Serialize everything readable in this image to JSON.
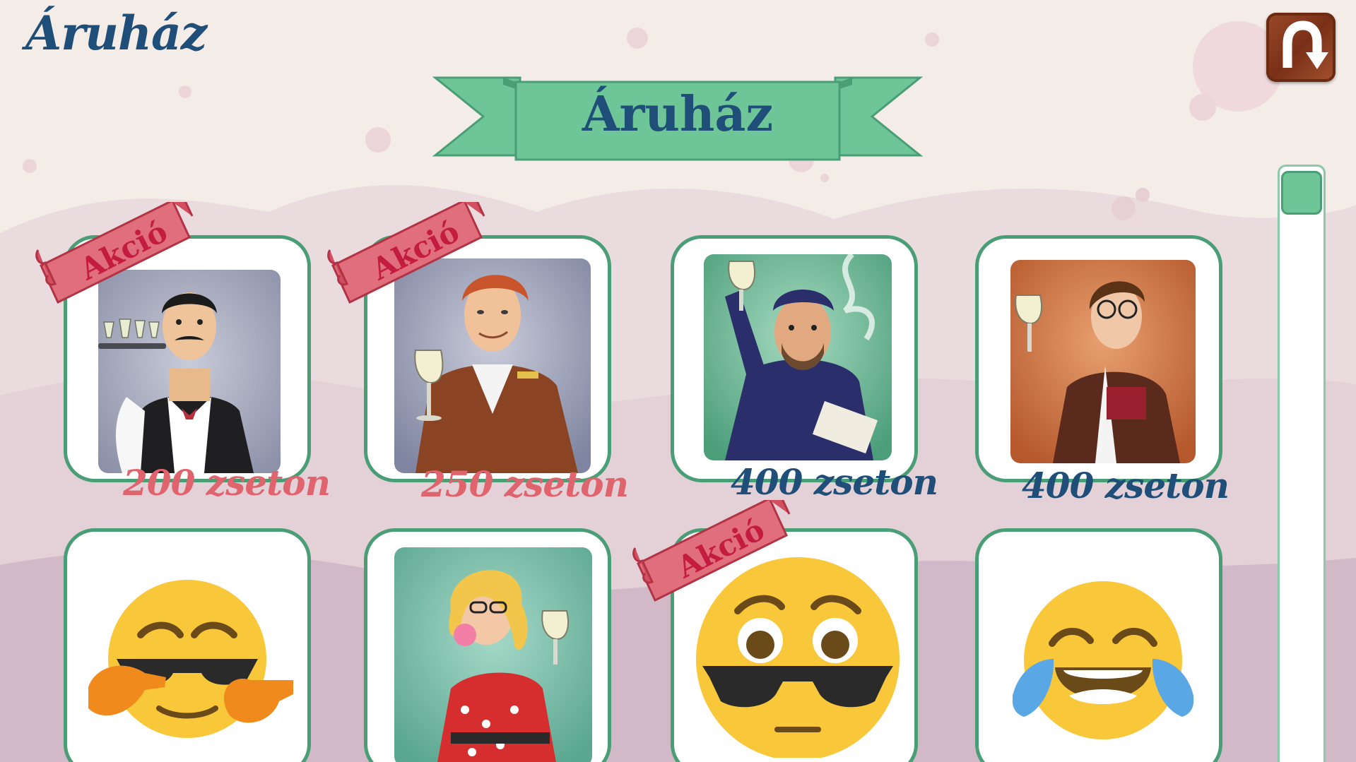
{
  "page": {
    "title": "Áruház",
    "banner_title": "Áruház",
    "back_icon": "u-turn-arrow-icon"
  },
  "colors": {
    "background": "#f4ece6",
    "title_blue": "#1f4e79",
    "banner_green": "#6dc598",
    "card_border": "#4a9e76",
    "sale_price": "#e0646e",
    "sale_ribbon": "#e06e7c"
  },
  "shop_items": [
    {
      "name": "waiter-avatar",
      "price": "200 zseton",
      "on_sale": true,
      "sale_label": "Akció"
    },
    {
      "name": "salesman-avatar",
      "price": "250 zseton",
      "on_sale": true,
      "sale_label": "Akció"
    },
    {
      "name": "worker-avatar",
      "price": "400 zseton",
      "on_sale": false
    },
    {
      "name": "sommelier-avatar",
      "price": "400 zseton",
      "on_sale": false
    },
    {
      "name": "cool-emoji-icon",
      "on_sale": false
    },
    {
      "name": "pinup-girl-avatar",
      "on_sale": false
    },
    {
      "name": "sunglasses-emoji-icon",
      "on_sale": true,
      "sale_label": "Akció"
    },
    {
      "name": "laughing-tears-emoji-icon",
      "on_sale": false
    }
  ]
}
